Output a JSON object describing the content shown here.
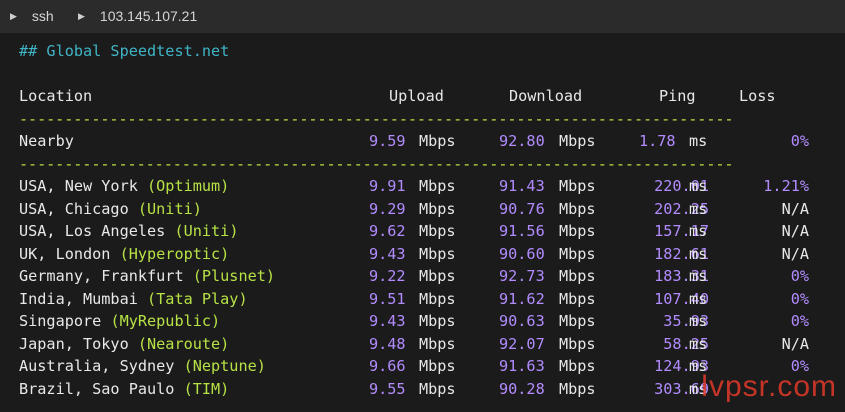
{
  "tabs": [
    {
      "label": "ssh"
    },
    {
      "label": "103.145.107.21"
    }
  ],
  "heading": "## Global Speedtest.net",
  "headers": {
    "location": "Location",
    "upload": "Upload",
    "download": "Download",
    "ping": "Ping",
    "loss": "Loss"
  },
  "separator": "-------------------------------------------------------------------------------",
  "nearby": {
    "location": "Nearby",
    "upload": "9.59",
    "upload_unit": "Mbps",
    "download": "92.80",
    "download_unit": "Mbps",
    "ping": "1.78",
    "ping_unit": "ms",
    "loss": "0%"
  },
  "rows": [
    {
      "city": "USA, New York ",
      "isp": "(Optimum)",
      "upload": "9.91",
      "upload_unit": "Mbps",
      "download": "91.43",
      "download_unit": "Mbps",
      "ping": "220.01",
      "ping_unit": "ms",
      "loss": "1.21%",
      "loss_color": "#b28cff"
    },
    {
      "city": "USA, Chicago ",
      "isp": "(Uniti)",
      "upload": "9.29",
      "upload_unit": "Mbps",
      "download": "90.76",
      "download_unit": "Mbps",
      "ping": "202.25",
      "ping_unit": "ms",
      "loss": "N/A",
      "loss_color": "#e8e8e8"
    },
    {
      "city": "USA, Los Angeles ",
      "isp": "(Uniti)",
      "upload": "9.62",
      "upload_unit": "Mbps",
      "download": "91.56",
      "download_unit": "Mbps",
      "ping": "157.17",
      "ping_unit": "ms",
      "loss": "N/A",
      "loss_color": "#e8e8e8"
    },
    {
      "city": "UK, London ",
      "isp": "(Hyperoptic)",
      "upload": "9.43",
      "upload_unit": "Mbps",
      "download": "90.60",
      "download_unit": "Mbps",
      "ping": "182.61",
      "ping_unit": "ms",
      "loss": "N/A",
      "loss_color": "#e8e8e8"
    },
    {
      "city": "Germany, Frankfurt ",
      "isp": "(Plusnet)",
      "upload": "9.22",
      "upload_unit": "Mbps",
      "download": "92.73",
      "download_unit": "Mbps",
      "ping": "183.31",
      "ping_unit": "ms",
      "loss": "0%",
      "loss_color": "#b28cff"
    },
    {
      "city": "India, Mumbai ",
      "isp": "(Tata Play)",
      "upload": "9.51",
      "upload_unit": "Mbps",
      "download": "91.62",
      "download_unit": "Mbps",
      "ping": "107.40",
      "ping_unit": "ms",
      "loss": "0%",
      "loss_color": "#b28cff"
    },
    {
      "city": "Singapore ",
      "isp": "(MyRepublic)",
      "upload": "9.43",
      "upload_unit": "Mbps",
      "download": "90.63",
      "download_unit": "Mbps",
      "ping": "35.93",
      "ping_unit": "ms",
      "loss": "0%",
      "loss_color": "#b28cff"
    },
    {
      "city": "Japan, Tokyo ",
      "isp": "(Nearoute)",
      "upload": "9.48",
      "upload_unit": "Mbps",
      "download": "92.07",
      "download_unit": "Mbps",
      "ping": "58.25",
      "ping_unit": "ms",
      "loss": "N/A",
      "loss_color": "#e8e8e8"
    },
    {
      "city": "Australia, Sydney ",
      "isp": "(Neptune)",
      "upload": "9.66",
      "upload_unit": "Mbps",
      "download": "91.63",
      "download_unit": "Mbps",
      "ping": "124.93",
      "ping_unit": "ms",
      "loss": "0%",
      "loss_color": "#b28cff"
    },
    {
      "city": "Brazil, Sao Paulo ",
      "isp": "(TIM)",
      "upload": "9.55",
      "upload_unit": "Mbps",
      "download": "90.28",
      "download_unit": "Mbps",
      "ping": "303.69",
      "ping_unit": "ms",
      "loss": "",
      "loss_color": "#b28cff"
    }
  ],
  "watermark": "lvpsr.com",
  "colors": {
    "background": "#1b1b1b",
    "tabbar": "#2b2b2b",
    "heading": "#3fb5c6",
    "separator": "#b7e246",
    "isp": "#b7e246",
    "numbers": "#b28cff",
    "text": "#e8e8e8",
    "watermark": "#e33a2a"
  }
}
